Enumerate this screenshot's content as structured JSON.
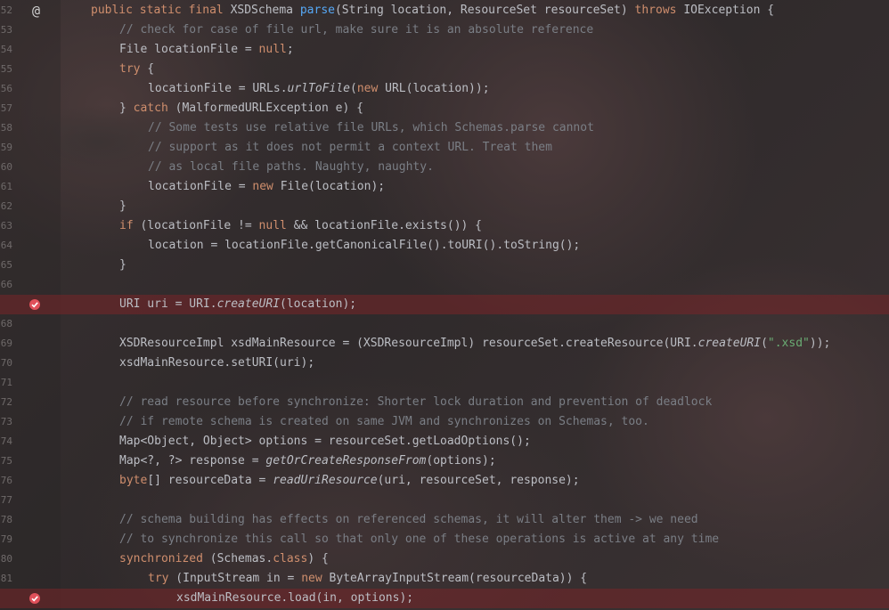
{
  "editor": {
    "gutter_marker": "@",
    "lines": [
      {
        "num": "52",
        "breakpoint": false,
        "marker": "override-at-icon",
        "tokens": [
          {
            "t": "public ",
            "c": "k"
          },
          {
            "t": "static ",
            "c": "k"
          },
          {
            "t": "final ",
            "c": "k"
          },
          {
            "t": "XSDSchema ",
            "c": ""
          },
          {
            "t": "parse",
            "c": "fn"
          },
          {
            "t": "(String location, ResourceSet resourceSet) ",
            "c": ""
          },
          {
            "t": "throws ",
            "c": "k"
          },
          {
            "t": "IOException {",
            "c": ""
          }
        ]
      },
      {
        "num": "53",
        "indent": 1,
        "tokens": [
          {
            "t": "// check for case of file url, make sure it is an absolute reference",
            "c": "c"
          }
        ]
      },
      {
        "num": "54",
        "indent": 1,
        "tokens": [
          {
            "t": "File locationFile = ",
            "c": ""
          },
          {
            "t": "null",
            "c": "k"
          },
          {
            "t": ";",
            "c": ""
          }
        ]
      },
      {
        "num": "55",
        "indent": 1,
        "tokens": [
          {
            "t": "try",
            "c": "k"
          },
          {
            "t": " {",
            "c": ""
          }
        ]
      },
      {
        "num": "56",
        "indent": 2,
        "tokens": [
          {
            "t": "locationFile = URLs.",
            "c": ""
          },
          {
            "t": "urlToFile",
            "c": "i"
          },
          {
            "t": "(",
            "c": ""
          },
          {
            "t": "new",
            "c": "k"
          },
          {
            "t": " URL(location));",
            "c": ""
          }
        ]
      },
      {
        "num": "57",
        "indent": 1,
        "tokens": [
          {
            "t": "} ",
            "c": ""
          },
          {
            "t": "catch",
            "c": "k"
          },
          {
            "t": " (MalformedURLException e) {",
            "c": ""
          }
        ]
      },
      {
        "num": "58",
        "indent": 2,
        "tokens": [
          {
            "t": "// Some tests use relative file URLs, which Schemas.parse cannot",
            "c": "c"
          }
        ]
      },
      {
        "num": "59",
        "indent": 2,
        "tokens": [
          {
            "t": "// support as it does not permit a context URL. Treat them",
            "c": "c"
          }
        ]
      },
      {
        "num": "60",
        "indent": 2,
        "tokens": [
          {
            "t": "// as local file paths. Naughty, naughty.",
            "c": "c"
          }
        ]
      },
      {
        "num": "61",
        "indent": 2,
        "tokens": [
          {
            "t": "locationFile = ",
            "c": ""
          },
          {
            "t": "new",
            "c": "k"
          },
          {
            "t": " File(location);",
            "c": ""
          }
        ]
      },
      {
        "num": "62",
        "indent": 1,
        "tokens": [
          {
            "t": "}",
            "c": ""
          }
        ]
      },
      {
        "num": "63",
        "indent": 1,
        "tokens": [
          {
            "t": "if",
            "c": "k"
          },
          {
            "t": " (locationFile != ",
            "c": ""
          },
          {
            "t": "null",
            "c": "k"
          },
          {
            "t": " && locationFile.exists()) {",
            "c": ""
          }
        ]
      },
      {
        "num": "64",
        "indent": 2,
        "tokens": [
          {
            "t": "location = locationFile.getCanonicalFile().toURI().toString();",
            "c": ""
          }
        ]
      },
      {
        "num": "65",
        "indent": 1,
        "tokens": [
          {
            "t": "}",
            "c": ""
          }
        ]
      },
      {
        "num": "66",
        "tokens": []
      },
      {
        "num": "67",
        "indent": 1,
        "breakpoint": true,
        "tokens": [
          {
            "t": "URI uri = URI.",
            "c": ""
          },
          {
            "t": "createURI",
            "c": "i"
          },
          {
            "t": "(location);",
            "c": ""
          }
        ]
      },
      {
        "num": "68",
        "tokens": []
      },
      {
        "num": "69",
        "indent": 1,
        "tokens": [
          {
            "t": "XSDResourceImpl xsdMainResource = (XSDResourceImpl) resourceSet.createResource(URI.",
            "c": ""
          },
          {
            "t": "createURI",
            "c": "i"
          },
          {
            "t": "(",
            "c": ""
          },
          {
            "t": "\".xsd\"",
            "c": "s"
          },
          {
            "t": "));",
            "c": ""
          }
        ]
      },
      {
        "num": "70",
        "indent": 1,
        "tokens": [
          {
            "t": "xsdMainResource.setURI(uri);",
            "c": ""
          }
        ]
      },
      {
        "num": "71",
        "tokens": []
      },
      {
        "num": "72",
        "indent": 1,
        "tokens": [
          {
            "t": "// read resource before synchronize: Shorter lock duration and prevention of deadlock",
            "c": "c"
          }
        ]
      },
      {
        "num": "73",
        "indent": 1,
        "tokens": [
          {
            "t": "// if remote schema is created on same JVM and synchronizes on Schemas, too.",
            "c": "c"
          }
        ]
      },
      {
        "num": "74",
        "indent": 1,
        "tokens": [
          {
            "t": "Map<Object, Object> options = resourceSet.getLoadOptions();",
            "c": ""
          }
        ]
      },
      {
        "num": "75",
        "indent": 1,
        "tokens": [
          {
            "t": "Map<?, ?> response = ",
            "c": ""
          },
          {
            "t": "getOrCreateResponseFrom",
            "c": "i"
          },
          {
            "t": "(options);",
            "c": ""
          }
        ]
      },
      {
        "num": "76",
        "indent": 1,
        "tokens": [
          {
            "t": "byte",
            "c": "k"
          },
          {
            "t": "[] resourceData = ",
            "c": ""
          },
          {
            "t": "readUriResource",
            "c": "i"
          },
          {
            "t": "(uri, resourceSet, response);",
            "c": ""
          }
        ]
      },
      {
        "num": "77",
        "tokens": []
      },
      {
        "num": "78",
        "indent": 1,
        "tokens": [
          {
            "t": "// schema building has effects on referenced schemas, it will alter them -> we need",
            "c": "c"
          }
        ]
      },
      {
        "num": "79",
        "indent": 1,
        "tokens": [
          {
            "t": "// to synchronize this call so that only one of these operations is active at any time",
            "c": "c"
          }
        ]
      },
      {
        "num": "80",
        "indent": 1,
        "tokens": [
          {
            "t": "synchronized",
            "c": "k"
          },
          {
            "t": " (Schemas.",
            "c": ""
          },
          {
            "t": "class",
            "c": "k"
          },
          {
            "t": ") {",
            "c": ""
          }
        ]
      },
      {
        "num": "81",
        "indent": 2,
        "tokens": [
          {
            "t": "try",
            "c": "k"
          },
          {
            "t": " (InputStream in = ",
            "c": ""
          },
          {
            "t": "new",
            "c": "k"
          },
          {
            "t": " ByteArrayInputStream(resourceData)) {",
            "c": ""
          }
        ]
      },
      {
        "num": "82",
        "indent": 3,
        "breakpoint": true,
        "tokens": [
          {
            "t": "xsdMainResource.load(in, options);",
            "c": ""
          }
        ]
      }
    ],
    "colors": {
      "keyword": "#cf8e6d",
      "comment": "#7a7e85",
      "string": "#6aab73",
      "method_decl": "#56a8f5",
      "breakpoint_line": "#782428",
      "breakpoint_icon": "#e0505a"
    }
  }
}
